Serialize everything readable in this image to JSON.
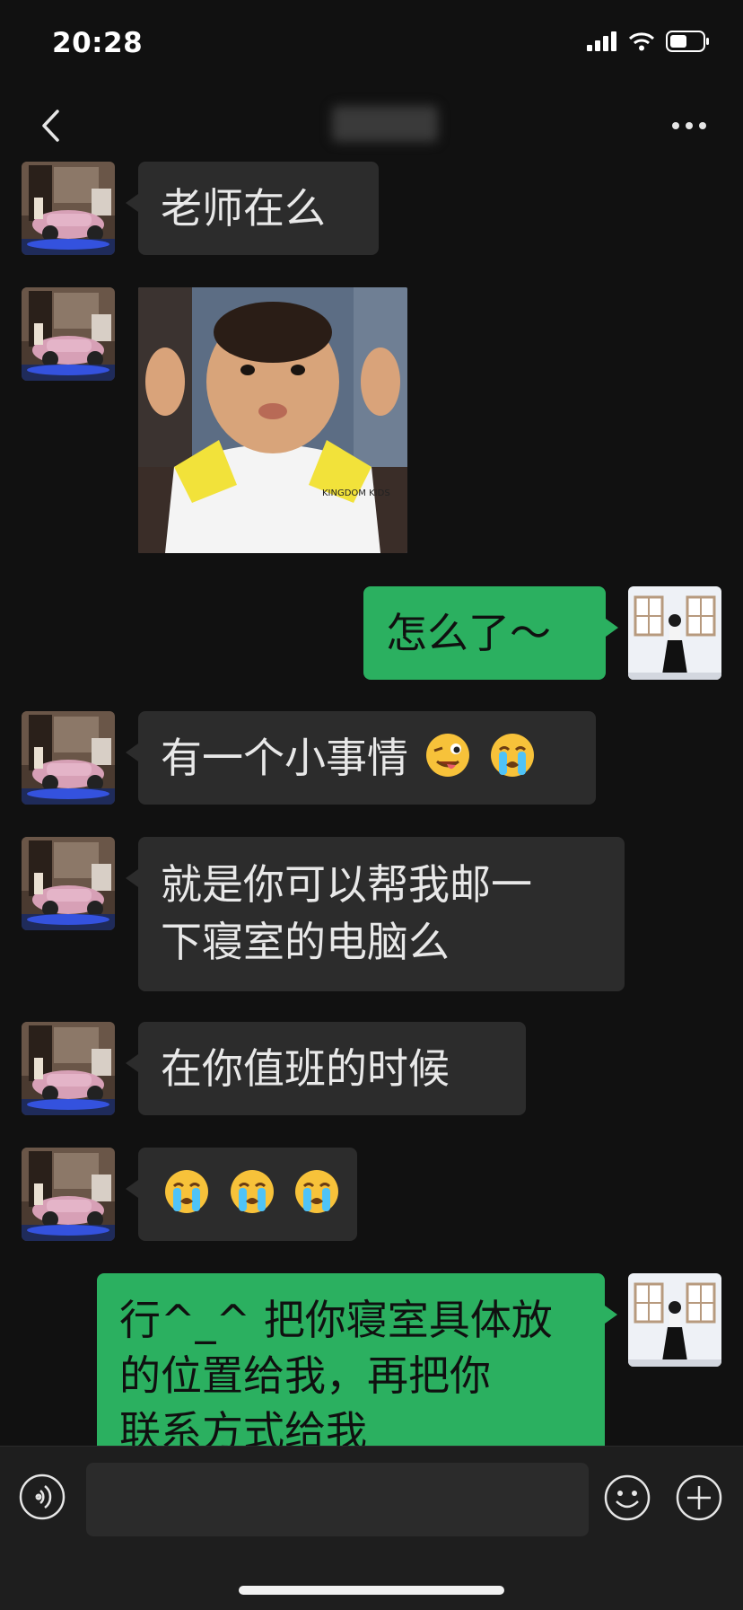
{
  "status_bar": {
    "time": "20:28"
  },
  "colors": {
    "background": "#111111",
    "incoming_bubble": "#2c2c2c",
    "outgoing_bubble": "#2bb060"
  },
  "nav": {
    "back_icon": "chevron-left-icon",
    "more_icon": "more-dots-icon"
  },
  "messages": [
    {
      "side": "left",
      "type": "text",
      "text": "老师在么"
    },
    {
      "side": "left",
      "type": "sticker",
      "sticker_caption": "KINGDOM KIDS"
    },
    {
      "side": "right",
      "type": "text",
      "text": "怎么了～"
    },
    {
      "side": "left",
      "type": "text",
      "text": "有一个小事情",
      "emojis": [
        "winking-tongue-emoji",
        "crying-emoji"
      ]
    },
    {
      "side": "left",
      "type": "text",
      "line1": "就是你可以帮我邮一",
      "line2": "下寝室的电脑么"
    },
    {
      "side": "left",
      "type": "text",
      "text": "在你值班的时候"
    },
    {
      "side": "left",
      "type": "emoji",
      "emojis": [
        "crying-emoji",
        "crying-emoji",
        "crying-emoji"
      ]
    },
    {
      "side": "right",
      "type": "text",
      "line1": "行^_^ 把你寝室具体放",
      "line2": "的位置给我，再把你",
      "line3": "联系方式给我"
    }
  ],
  "input_bar": {
    "voice_icon": "voice-icon",
    "emoji_icon": "emoji-face-icon",
    "plus_icon": "plus-circle-icon",
    "text_value": ""
  }
}
